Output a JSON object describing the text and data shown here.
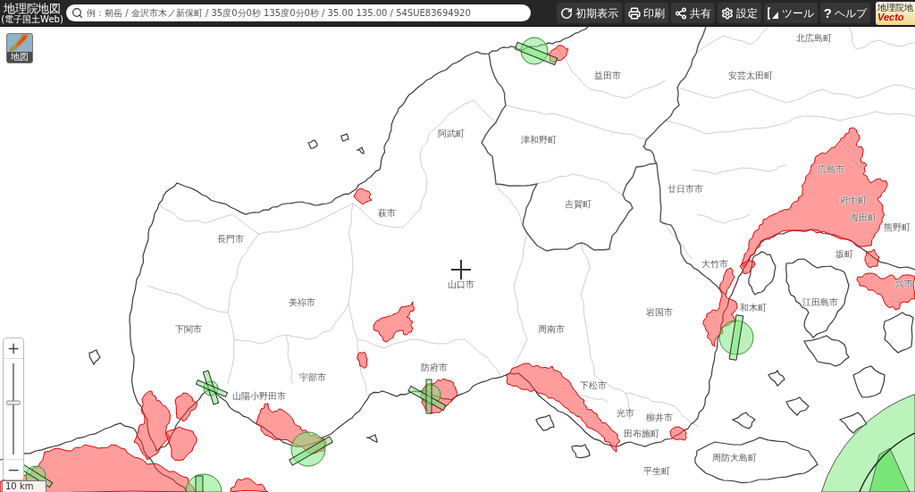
{
  "header": {
    "logo": {
      "title": "地理院地図",
      "subtitle": "(電子国土Web)"
    },
    "search": {
      "placeholder": "例：剱岳 / 金沢市木ノ新保町 / 35度0分0秒 135度0分0秒 / 35.00 135.00 / 54SUE83694920"
    },
    "tools": [
      {
        "label": "初期表示"
      },
      {
        "label": "印刷"
      },
      {
        "label": "共有"
      },
      {
        "label": "設定"
      },
      {
        "label": "ツール"
      },
      {
        "label": "ヘルプ",
        "glyph": "?"
      }
    ],
    "badge": {
      "line_1": "地理院地",
      "line_2": "Vecto"
    }
  },
  "layer_button": {
    "label": "地図"
  },
  "map": {
    "places": [
      "北広島町",
      "益田市",
      "安芸太田町",
      "阿武町",
      "津和野町",
      "広島市",
      "廿日市市",
      "府中町",
      "吉賀町",
      "萩市",
      "海田町",
      "熊野町",
      "長門市",
      "坂町",
      "大竹市",
      "呉市",
      "山口市",
      "美祢市",
      "江田島市",
      "和木町",
      "岩国市",
      "下関市",
      "周南市",
      "防府市",
      "宇部市",
      "下松市",
      "山陽小野田市",
      "光市",
      "柳井市",
      "田布施町",
      "周防大島町",
      "平生町"
    ]
  },
  "zoom_control": {
    "zoom_in": "+",
    "zoom_out": "−",
    "level": 0.57
  },
  "scale_bar": {
    "label": "10 km"
  }
}
